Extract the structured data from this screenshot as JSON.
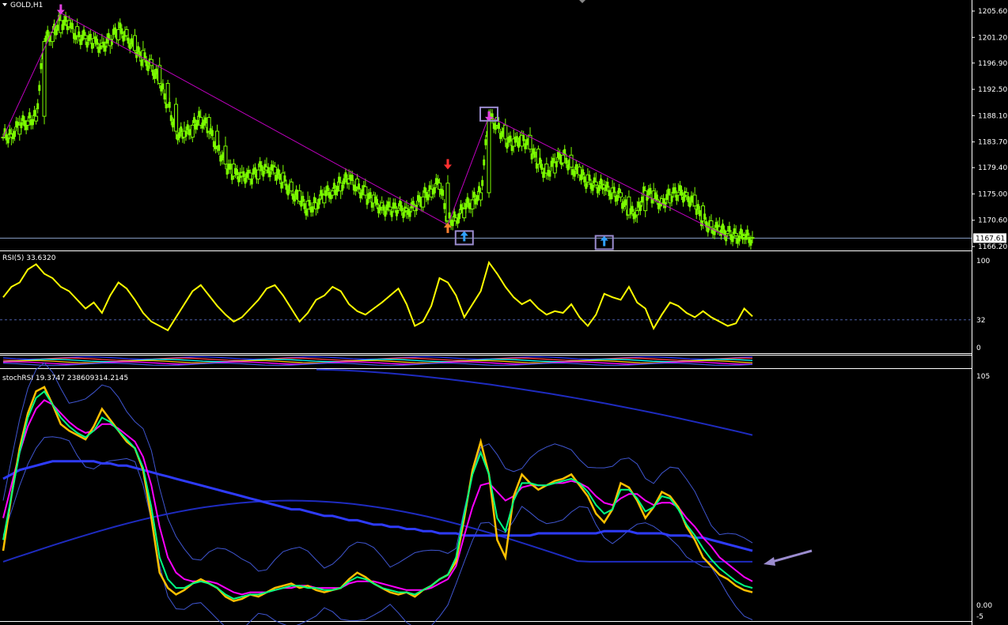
{
  "chart_title": "GOLD,H1",
  "price_pane": {
    "y_ticks": [
      "1205.60",
      "1201.20",
      "1196.90",
      "1192.50",
      "1188.10",
      "1183.70",
      "1179.40",
      "1175.00",
      "1170.60",
      "1166.20"
    ],
    "current_price": "1167.61",
    "colors": {
      "candles": "#7cfc00",
      "zigzag": "#c000c0",
      "pointer_line": "#8080c0",
      "box": "#9b8ccf"
    }
  },
  "rsi_pane": {
    "label": "RSI(5) 33.6320",
    "y_ticks": [
      "100",
      "32",
      "0"
    ],
    "colors": {
      "line": "#ffff00",
      "level": "#4a5ea8"
    }
  },
  "stoch_pane": {
    "label": "stochRSI 19.3747 238609314.2145",
    "y_ticks": [
      "105",
      "0.00",
      "-5"
    ],
    "colors": {
      "fast": "#ffc000",
      "signal": "#00ff7f",
      "slow": "#ff00ff",
      "ma": "#2e3bff",
      "bands": "#3f55d0",
      "arrow": "#9b8ccf"
    }
  },
  "chart_data": [
    {
      "type": "candlestick",
      "symbol": "GOLD",
      "timeframe": "H1",
      "ylim": [
        1166.2,
        1205.6
      ],
      "x": "bar index",
      "close": [
        1184.5,
        1185.0,
        1186.5,
        1187.2,
        1188.0,
        1200.5,
        1202.0,
        1204.0,
        1203.0,
        1201.5,
        1201.0,
        1200.2,
        1199.8,
        1200.8,
        1202.5,
        1201.5,
        1199.0,
        1197.5,
        1196.5,
        1193.5,
        1190.0,
        1185.5,
        1184.5,
        1186.5,
        1187.8,
        1185.5,
        1183.0,
        1180.0,
        1178.0,
        1178.5,
        1177.5,
        1179.0,
        1179.5,
        1178.5,
        1177.0,
        1175.5,
        1173.8,
        1172.5,
        1173.5,
        1174.8,
        1175.5,
        1176.8,
        1177.5,
        1176.2,
        1174.8,
        1173.5,
        1172.8,
        1172.3,
        1172.6,
        1172.2,
        1172.8,
        1174.5,
        1175.8,
        1176.8,
        1170.5,
        1171.0,
        1172.5,
        1174.0,
        1175.2,
        1187.8,
        1186.5,
        1184.2,
        1183.0,
        1184.8,
        1182.5,
        1180.0,
        1178.5,
        1180.2,
        1181.5,
        1179.5,
        1178.2,
        1177.0,
        1176.5,
        1176.0,
        1175.2,
        1174.5,
        1171.5,
        1172.2,
        1175.5,
        1174.2,
        1173.5,
        1174.8,
        1175.2,
        1174.8,
        1173.0,
        1170.5,
        1169.5,
        1168.8,
        1168.4,
        1168.0,
        1167.7,
        1167.6
      ],
      "markers": [
        {
          "type": "down-arrow",
          "color": "#e040e0"
        },
        {
          "type": "down-arrow",
          "color": "#ff3030"
        },
        {
          "type": "up-arrow",
          "color": "#ff8030"
        },
        {
          "type": "up-arrow",
          "color": "#30a0ff",
          "boxed": true
        },
        {
          "type": "down-arrow",
          "color": "#e040e0",
          "boxed": true
        },
        {
          "type": "up-arrow",
          "color": "#30a0ff",
          "boxed": true
        }
      ]
    },
    {
      "type": "line",
      "name": "RSI(5)",
      "ylim": [
        0,
        100
      ],
      "level": 32,
      "values": [
        58,
        70,
        75,
        90,
        96,
        85,
        80,
        70,
        65,
        55,
        45,
        52,
        40,
        60,
        75,
        68,
        55,
        40,
        30,
        25,
        20,
        35,
        50,
        65,
        72,
        60,
        48,
        38,
        30,
        35,
        45,
        55,
        68,
        72,
        60,
        45,
        30,
        40,
        55,
        60,
        70,
        65,
        50,
        42,
        38,
        45,
        52,
        60,
        68,
        50,
        25,
        30,
        48,
        80,
        75,
        60,
        35,
        50,
        65,
        98,
        85,
        70,
        58,
        50,
        55,
        45,
        38,
        42,
        40,
        50,
        35,
        25,
        38,
        62,
        58,
        55,
        70,
        52,
        45,
        22,
        38,
        52,
        48,
        40,
        35,
        42,
        35,
        30,
        25,
        28,
        45,
        36
      ]
    },
    {
      "type": "line",
      "name": "stochRSI",
      "ylim": [
        -5,
        105
      ],
      "series": [
        {
          "values": [
            25,
            50,
            72,
            88,
            98,
            100,
            92,
            83,
            80,
            78,
            76,
            82,
            90,
            85,
            80,
            75,
            72,
            62,
            40,
            15,
            8,
            5,
            7,
            10,
            12,
            10,
            8,
            4,
            2,
            3,
            5,
            4,
            6,
            8,
            9,
            10,
            8,
            9,
            7,
            6,
            7,
            8,
            12,
            15,
            13,
            10,
            8,
            6,
            5,
            6,
            4,
            7,
            9,
            12,
            14,
            20,
            40,
            62,
            75,
            60,
            30,
            22,
            50,
            60,
            56,
            53,
            55,
            57,
            58,
            60,
            55,
            50,
            42,
            38,
            44,
            56,
            54,
            48,
            40,
            45,
            52,
            50,
            45,
            36,
            30,
            22,
            18,
            14,
            12,
            9,
            7,
            6
          ]
        },
        {
          "values": [
            30,
            50,
            70,
            86,
            95,
            98,
            92,
            86,
            82,
            79,
            77,
            80,
            86,
            84,
            80,
            76,
            72,
            63,
            45,
            22,
            12,
            8,
            8,
            10,
            11,
            10,
            8,
            5,
            3,
            4,
            5,
            5,
            6,
            7,
            8,
            9,
            9,
            8,
            8,
            7,
            7,
            8,
            11,
            13,
            12,
            10,
            8,
            7,
            6,
            6,
            5,
            7,
            9,
            12,
            14,
            22,
            42,
            60,
            70,
            60,
            40,
            34,
            48,
            56,
            56,
            55,
            55,
            56,
            57,
            58,
            56,
            52,
            46,
            42,
            44,
            53,
            53,
            49,
            43,
            45,
            50,
            49,
            44,
            37,
            32,
            26,
            21,
            17,
            14,
            11,
            9,
            8
          ]
        },
        {
          "values": [
            40,
            55,
            70,
            82,
            90,
            94,
            92,
            88,
            84,
            81,
            79,
            80,
            83,
            83,
            81,
            78,
            75,
            68,
            55,
            36,
            22,
            15,
            12,
            11,
            11,
            11,
            10,
            8,
            6,
            5,
            6,
            6,
            6,
            7,
            8,
            8,
            9,
            9,
            8,
            8,
            8,
            8,
            10,
            11,
            11,
            11,
            10,
            9,
            8,
            7,
            7,
            7,
            8,
            10,
            12,
            18,
            32,
            45,
            55,
            56,
            52,
            48,
            50,
            54,
            55,
            55,
            55,
            56,
            56,
            57,
            56,
            54,
            50,
            47,
            46,
            49,
            51,
            51,
            48,
            46,
            47,
            47,
            45,
            40,
            36,
            31,
            27,
            22,
            19,
            16,
            13,
            11
          ]
        },
        {
          "values": [
            58,
            60,
            62,
            63,
            64,
            65,
            66,
            66,
            66,
            66,
            66,
            66,
            65,
            65,
            64,
            64,
            63,
            62,
            61,
            60,
            59,
            58,
            57,
            56,
            55,
            54,
            53,
            52,
            51,
            50,
            49,
            48,
            47,
            46,
            45,
            44,
            44,
            43,
            42,
            41,
            41,
            40,
            39,
            39,
            38,
            37,
            37,
            36,
            36,
            35,
            35,
            34,
            34,
            33,
            33,
            33,
            32,
            32,
            32,
            32,
            32,
            32,
            32,
            32,
            32,
            33,
            33,
            33,
            33,
            33,
            33,
            33,
            33,
            34,
            34,
            34,
            34,
            33,
            33,
            33,
            33,
            32,
            32,
            32,
            31,
            31,
            30,
            29,
            28,
            27,
            26,
            25
          ]
        }
      ]
    }
  ]
}
